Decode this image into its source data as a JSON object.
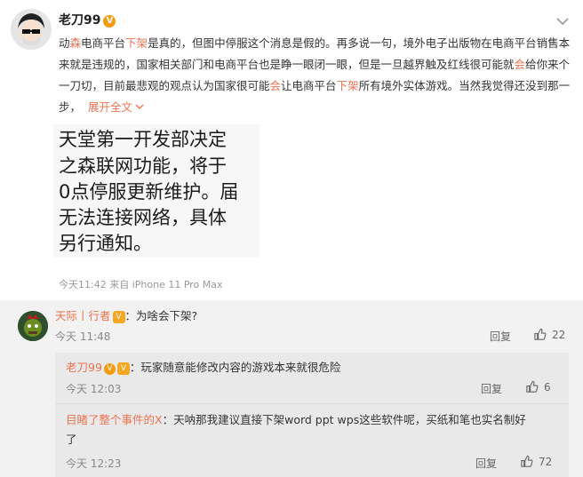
{
  "post": {
    "author": "老刀99",
    "body_parts": [
      {
        "t": "动",
        "hl": false
      },
      {
        "t": "森",
        "hl": true
      },
      {
        "t": "电商平台",
        "hl": false
      },
      {
        "t": "下架",
        "hl": true
      },
      {
        "t": "是真的，但图中停服这个消息是假的。再多说一句，境外电子出版物在电商平台销售本来就是违规的，国家相关部门和电商平台也是睁一眼闭一眼，但是一旦越界触及红线很可能就",
        "hl": false
      },
      {
        "t": "会",
        "hl": true
      },
      {
        "t": "给你来个一刀切，目前最悲观的观点认为国家很可能",
        "hl": false
      },
      {
        "t": "会",
        "hl": true
      },
      {
        "t": "让电商平台",
        "hl": false
      },
      {
        "t": "下架",
        "hl": true
      },
      {
        "t": "所有境外实体游戏。当然我觉得还没到那一步，",
        "hl": false
      }
    ],
    "expand_label": "展开全文",
    "image_lines": [
      "天堂第一开发部决定",
      "之森联网功能，将于",
      "0点停服更新维护。届",
      "无法连接网络，具体",
      "另行通知。"
    ],
    "meta": "今天11:42 来自 iPhone 11 Pro Max"
  },
  "comments": [
    {
      "name": "天际丨行者",
      "text": "为啥会下架?",
      "time": "今天 11:48",
      "reply_label": "回复",
      "likes": "22"
    }
  ],
  "replies": [
    {
      "name": "老刀99",
      "text": "玩家随意能修改内容的游戏本来就很危险",
      "time": "今天 12:03",
      "reply_label": "回复",
      "likes": "6"
    },
    {
      "name": "目睹了整个事件的X",
      "text_line1": "天呐那我建议直接下架word ppt wps这些软件呢，买纸和笔也实名制好",
      "text_line2": "了",
      "time": "今天 12:23",
      "reply_label": "回复",
      "likes": "72"
    }
  ],
  "colors": {
    "accent": "#eb7350",
    "badge": "#f39c12"
  }
}
